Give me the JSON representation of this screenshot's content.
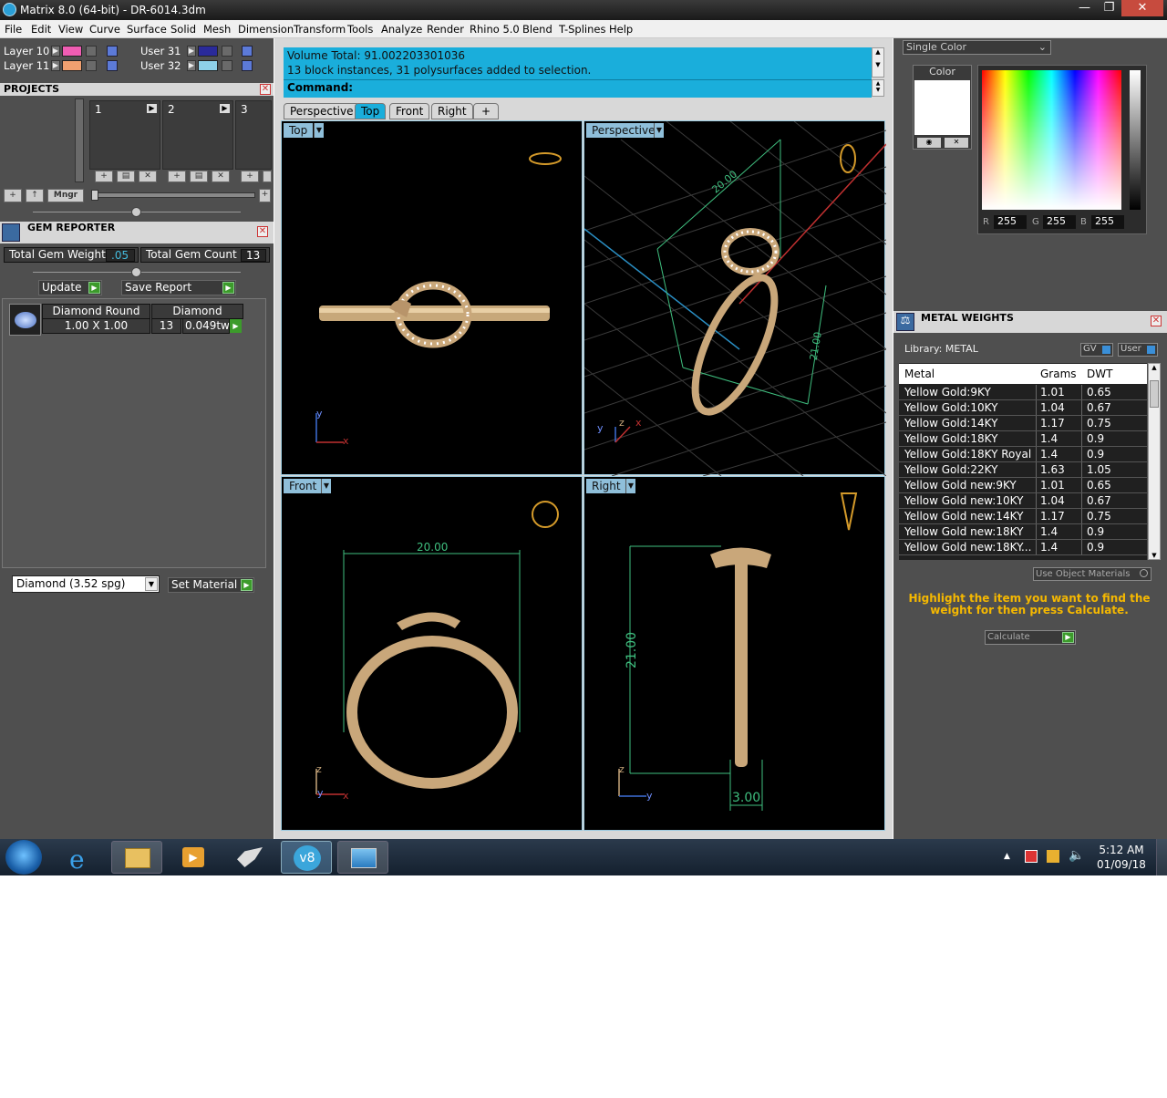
{
  "window": {
    "title": "Matrix 8.0 (64-bit) - DR-6014.3dm",
    "controls": [
      "—",
      "❐",
      "✕"
    ]
  },
  "menu": [
    "File",
    "Edit",
    "View",
    "Curve",
    "Surface",
    "Solid",
    "Mesh",
    "Dimension",
    "Transform",
    "Tools",
    "Analyze",
    "Render",
    "Rhino 5.0",
    "Blend",
    "T-Splines",
    "Help"
  ],
  "layers": {
    "left": [
      {
        "name": "Layer 10",
        "color": "#ef5db3"
      },
      {
        "name": "Layer 11",
        "color": "#f0a070"
      }
    ],
    "right": [
      {
        "name": "User 31",
        "color": "#2a2a9a"
      },
      {
        "name": "User 32",
        "color": "#8ed0e8"
      }
    ]
  },
  "projects": {
    "title": "PROJECTS",
    "slots": [
      "1",
      "2",
      "3"
    ],
    "mngr": "Mngr",
    "buttons": [
      "+",
      "↑"
    ]
  },
  "gem_reporter": {
    "title": "GEM REPORTER",
    "total_weight_label": "Total Gem Weight",
    "total_weight": ".05",
    "total_count_label": "Total Gem Count",
    "total_count": "13",
    "update": "Update",
    "save_report": "Save Report",
    "gem": {
      "shape": "Diamond Round",
      "material": "Diamond",
      "size": "1.00 X 1.00",
      "count": "13",
      "weight": "0.049tw"
    },
    "material_select": "Diamond    (3.52 spg)",
    "set_material": "Set Material"
  },
  "command": {
    "line1": "Volume Total: 91.002203301036",
    "line2": "13 block instances, 31 polysurfaces added to selection.",
    "prompt": "Command:"
  },
  "tabs": [
    "Perspective",
    "Top",
    "Front",
    "Right",
    "+"
  ],
  "active_tab": "Top",
  "viewports": {
    "top": {
      "label": "Top"
    },
    "perspective": {
      "label": "Perspective",
      "dim1": "20.00",
      "dim2": "21.00"
    },
    "front": {
      "label": "Front",
      "dim": "20.00"
    },
    "right": {
      "label": "Right",
      "dim_height": "21.00",
      "dim_width": "3.00"
    }
  },
  "axes": {
    "x": "x",
    "y": "y",
    "z": "z"
  },
  "color_panel": {
    "mode": "Single Color",
    "color_label": "Color",
    "r_label": "R",
    "r": "255",
    "g_label": "G",
    "g": "255",
    "b_label": "B",
    "b": "255"
  },
  "metal_weights": {
    "title": "METAL WEIGHTS",
    "library": "Library: METAL",
    "gv": "GV",
    "user": "User",
    "headers": [
      "Metal",
      "Grams",
      "DWT"
    ],
    "rows": [
      [
        "Yellow Gold:9KY",
        "1.01",
        "0.65"
      ],
      [
        "Yellow Gold:10KY",
        "1.04",
        "0.67"
      ],
      [
        "Yellow Gold:14KY",
        "1.17",
        "0.75"
      ],
      [
        "Yellow Gold:18KY",
        "1.4",
        "0.9"
      ],
      [
        "Yellow Gold:18KY Royal",
        "1.4",
        "0.9"
      ],
      [
        "Yellow Gold:22KY",
        "1.63",
        "1.05"
      ],
      [
        "Yellow Gold new:9KY",
        "1.01",
        "0.65"
      ],
      [
        "Yellow Gold new:10KY",
        "1.04",
        "0.67"
      ],
      [
        "Yellow Gold new:14KY",
        "1.17",
        "0.75"
      ],
      [
        "Yellow Gold new:18KY",
        "1.4",
        "0.9"
      ],
      [
        "Yellow Gold new:18KY...",
        "1.4",
        "0.9"
      ]
    ],
    "use_object_materials": "Use Object Materials",
    "instruction": "Highlight the item you want to find the weight for then press Calculate.",
    "calculate": "Calculate"
  },
  "taskbar": {
    "time": "5:12 AM",
    "date": "01/09/18"
  }
}
